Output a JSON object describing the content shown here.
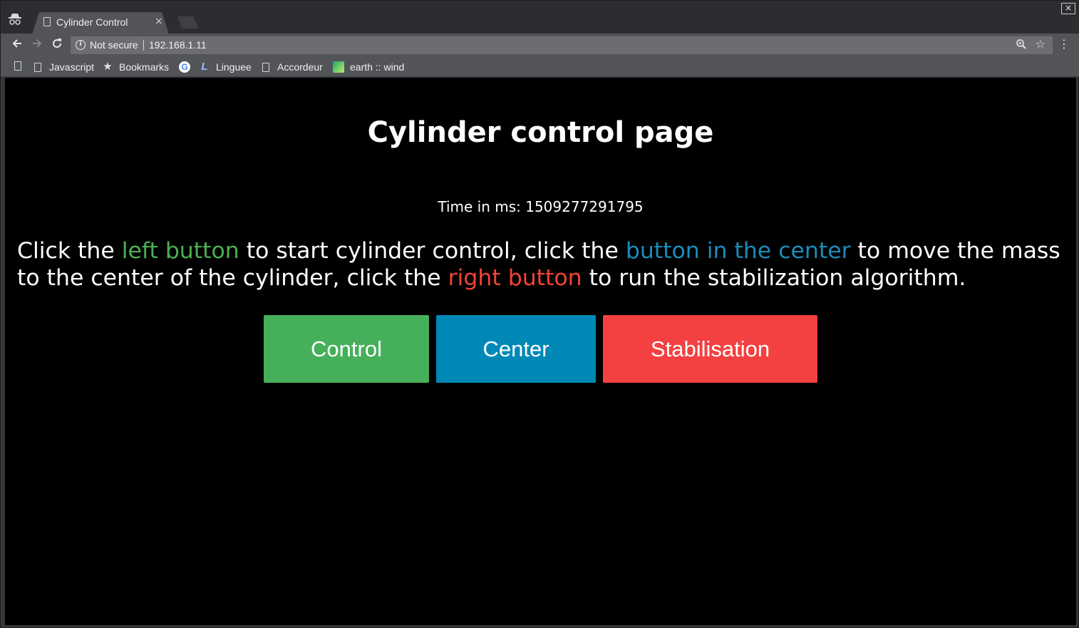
{
  "browser": {
    "tab_title": "Cylinder Control",
    "tab_close": "×",
    "window_close": "×",
    "security_label": "Not secure",
    "url": "192.168.1.11",
    "bookmarks": [
      {
        "label": "Javascript",
        "icon": "page-icon"
      },
      {
        "label": "Bookmarks",
        "icon": "star-icon"
      },
      {
        "label": "",
        "icon": "google-icon"
      },
      {
        "label": "Linguee",
        "icon": "linguee-icon"
      },
      {
        "label": "Accordeur",
        "icon": "page-icon"
      },
      {
        "label": "earth :: wind",
        "icon": "earth-icon"
      }
    ]
  },
  "page": {
    "title": "Cylinder control page",
    "time_label": "Time in ms: 1509277291795",
    "instructions": {
      "part1": "Click the ",
      "left_button": "left button",
      "part2": " to start cylinder control, click the ",
      "center_button": "button in the center",
      "part3": " to move the mass to the center of the cylinder, click the ",
      "right_button": "right button",
      "part4": " to run the stabilization algorithm."
    },
    "buttons": {
      "control": "Control",
      "center": "Center",
      "stabilisation": "Stabilisation"
    }
  },
  "colors": {
    "control": "#46af5a",
    "center": "#0088b6",
    "stabilisation": "#f44040",
    "page_background": "#000000"
  }
}
